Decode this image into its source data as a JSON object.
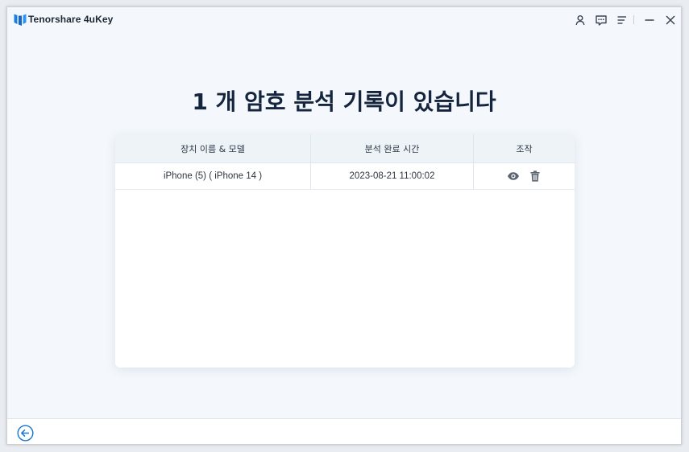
{
  "app": {
    "title": "Tenorshare 4uKey"
  },
  "titlebar": {
    "icons": [
      "account-icon",
      "feedback-icon",
      "menu-icon",
      "minimize-icon",
      "close-icon"
    ]
  },
  "main": {
    "heading": "1 개 암호 분석 기록이 있습니다"
  },
  "table": {
    "headers": {
      "device": "장치 이름 & 모델",
      "time": "분석 완료 시간",
      "action": "조작"
    },
    "rows": [
      {
        "device": "iPhone (5) ( iPhone 14 )",
        "time": "2023-08-21 11:00:02",
        "actions": [
          "view-icon",
          "delete-icon"
        ]
      }
    ]
  },
  "footer": {
    "back_icon": "back-arrow-icon"
  },
  "colors": {
    "accent": "#1677d2",
    "heading": "#15253d",
    "window_bg": "#f4f8fc",
    "table_header_bg": "#eef3f8"
  }
}
